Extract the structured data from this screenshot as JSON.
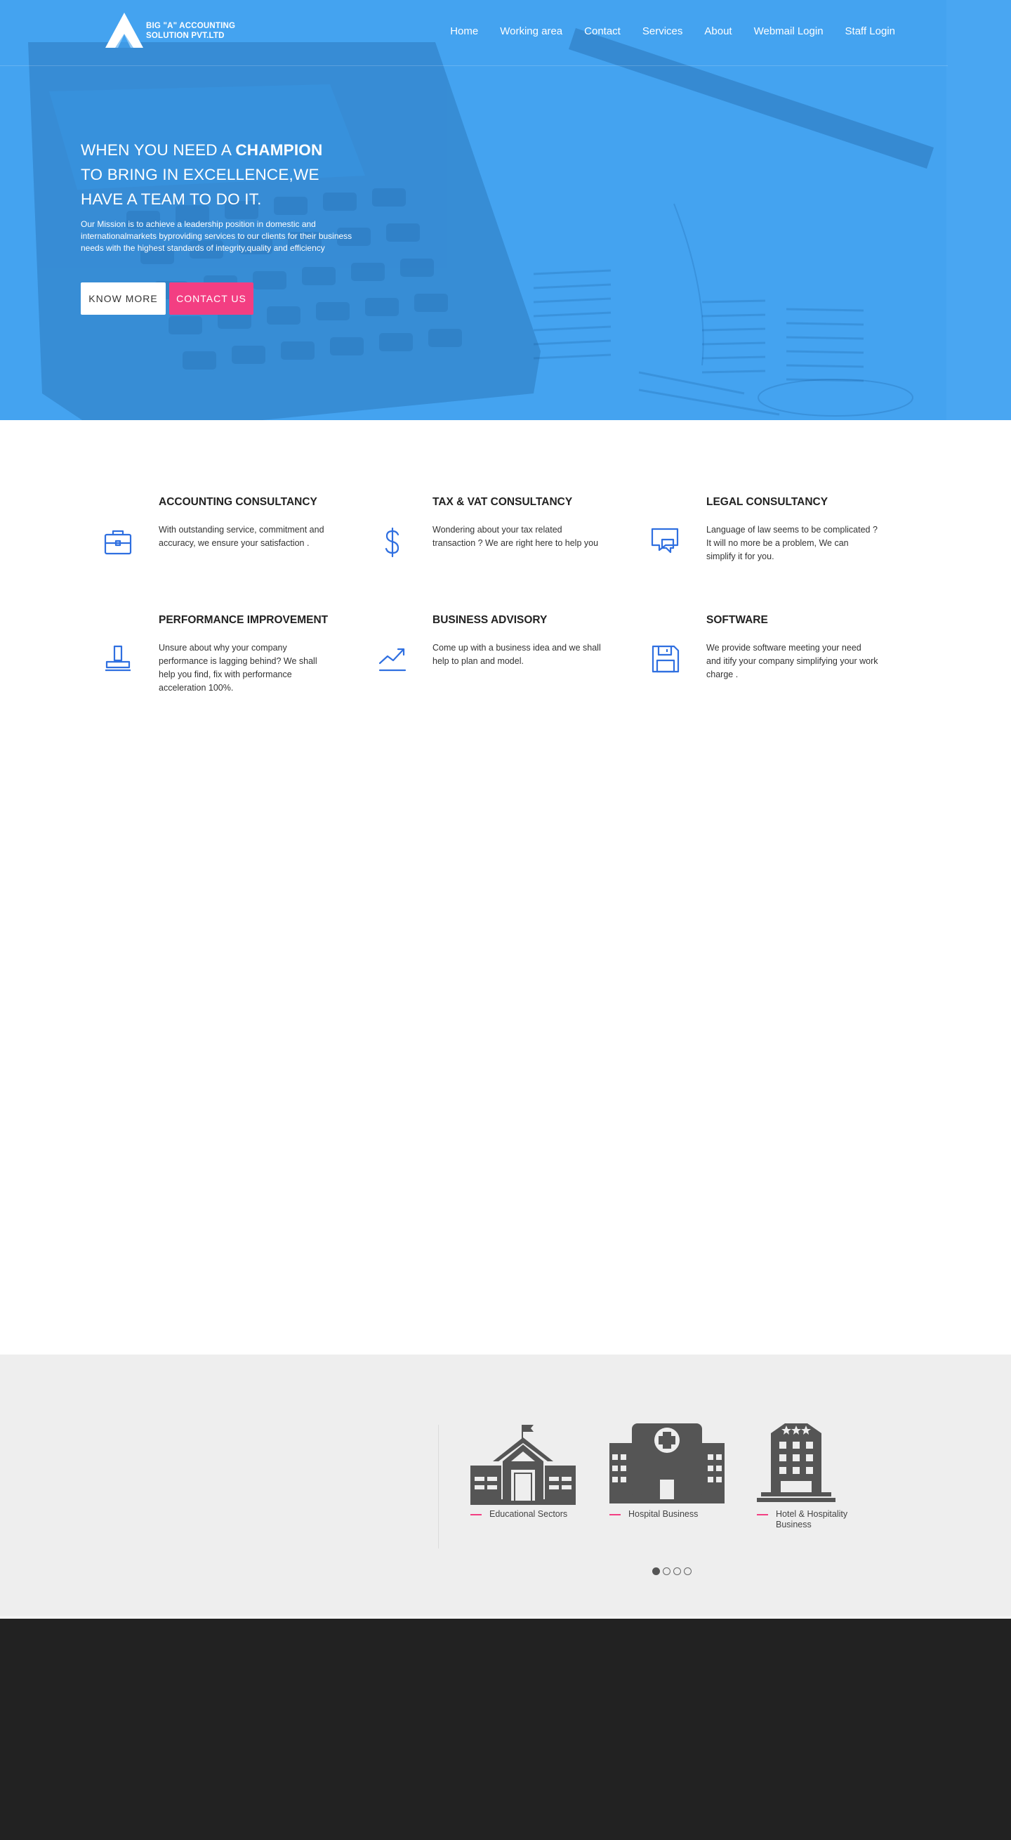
{
  "brand": {
    "line1": "BIG \"A\" ACCOUNTING",
    "line2": "SOLUTION PVT.LTD"
  },
  "nav": [
    {
      "label": "Home"
    },
    {
      "label": "Working area"
    },
    {
      "label": "Contact"
    },
    {
      "label": "Services"
    },
    {
      "label": "About"
    },
    {
      "label": "Webmail Login"
    },
    {
      "label": "Staff Login"
    }
  ],
  "hero": {
    "headline_line1_pre": "WHEN YOU NEED A ",
    "headline_line1_bold": "CHAMPION",
    "headline_line2": "TO BRING IN EXCELLENCE,WE",
    "headline_line3": "HAVE A TEAM TO DO IT.",
    "mission": "Our Mission is to achieve a leadership position in domestic and internationalmarkets byproviding services to our clients for their business needs with the highest standards of integrity,quality and efficiency",
    "know_more": "KNOW MORE",
    "contact_us": "CONTACT US"
  },
  "services": [
    {
      "title": "ACCOUNTING CONSULTANCY",
      "desc": "With outstanding service, commitment and accuracy, we ensure your satisfaction .",
      "icon": "briefcase-icon"
    },
    {
      "title": "TAX & VAT CONSULTANCY",
      "desc": "Wondering about your tax related transaction ? We are right here to help you",
      "icon": "dollar-icon"
    },
    {
      "title": "LEGAL CONSULTANCY",
      "desc": "Language of law seems to be complicated ? It will no more be a problem, We can simplify it for you.",
      "icon": "chat-bubbles-icon"
    },
    {
      "title": "PERFORMANCE IMPROVEMENT",
      "desc": "Unsure about why your company performance is lagging behind? We shall help you find, fix with performance acceleration 100%.",
      "icon": "stamp-icon"
    },
    {
      "title": "BUSINESS ADVISORY",
      "desc": "Come up with a business idea and we shall help to plan and model.",
      "icon": "trend-up-icon"
    },
    {
      "title": "SOFTWARE",
      "desc": "We provide software meeting your need and itify your company simplifying your work charge .",
      "icon": "floppy-disk-icon"
    }
  ],
  "industries": [
    {
      "label": "Educational Sectors",
      "icon": "school-icon"
    },
    {
      "label": "Hospital Business",
      "icon": "hospital-icon"
    },
    {
      "label": "Hotel & Hospitality Business",
      "icon": "hotel-icon"
    }
  ],
  "carousel": {
    "total": 4,
    "active": 1
  },
  "colors": {
    "hero_blue": "#44a3f0",
    "accent_pink": "#f33e82",
    "icon_blue": "#2f6fe0",
    "industry_gray": "#555555",
    "footer": "#222222"
  }
}
